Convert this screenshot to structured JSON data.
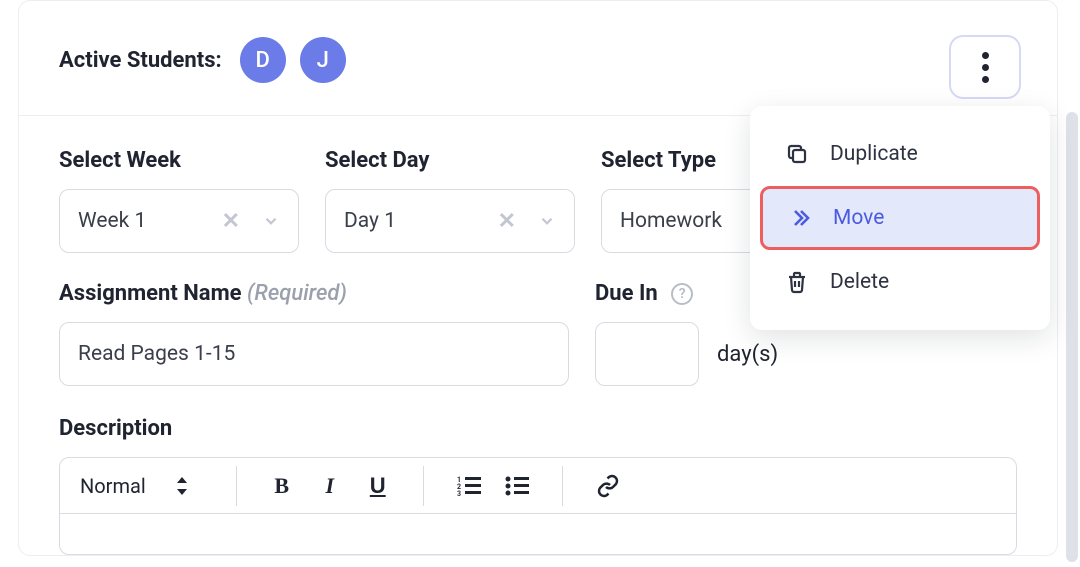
{
  "header": {
    "active_label": "Active Students:",
    "students": [
      "D",
      "J"
    ]
  },
  "fields": {
    "select_week": {
      "label": "Select Week",
      "value": "Week 1"
    },
    "select_day": {
      "label": "Select Day",
      "value": "Day 1"
    },
    "select_type": {
      "label": "Select Type",
      "value": "Homework"
    },
    "assignment_name": {
      "label": "Assignment Name",
      "required_hint": "(Required)",
      "value": "Read Pages 1-15"
    },
    "due_in": {
      "label": "Due In",
      "value": "",
      "unit": "day(s)"
    },
    "description": {
      "label": "Description"
    }
  },
  "editor": {
    "format_value": "Normal"
  },
  "menu": {
    "duplicate": "Duplicate",
    "move": "Move",
    "delete": "Delete"
  }
}
